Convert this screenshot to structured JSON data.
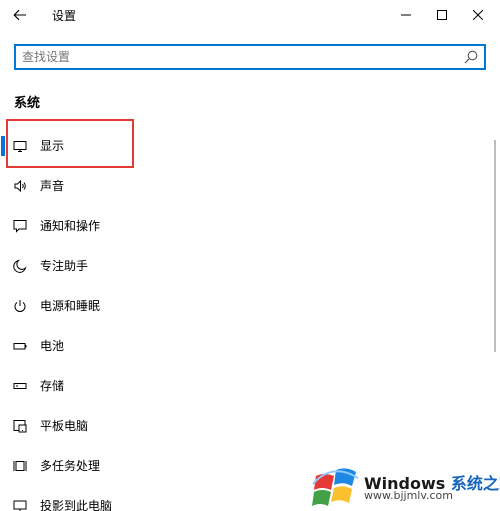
{
  "window": {
    "title": "设置"
  },
  "search": {
    "placeholder": "查找设置"
  },
  "section": {
    "title": "系统"
  },
  "items": [
    {
      "label": "显示",
      "icon": "monitor-icon",
      "selected": true
    },
    {
      "label": "声音",
      "icon": "speaker-icon"
    },
    {
      "label": "通知和操作",
      "icon": "notification-icon"
    },
    {
      "label": "专注助手",
      "icon": "moon-icon"
    },
    {
      "label": "电源和睡眠",
      "icon": "power-icon"
    },
    {
      "label": "电池",
      "icon": "battery-icon"
    },
    {
      "label": "存储",
      "icon": "storage-icon"
    },
    {
      "label": "平板电脑",
      "icon": "tablet-icon"
    },
    {
      "label": "多任务处理",
      "icon": "multitask-icon"
    },
    {
      "label": "投影到此电脑",
      "icon": "project-icon"
    }
  ],
  "watermark": {
    "brand": "Windows",
    "brand_cn": "系统之家",
    "url": "www.bjjmlv.com"
  },
  "colors": {
    "accent": "#0078d7",
    "highlight": "#e53935"
  }
}
